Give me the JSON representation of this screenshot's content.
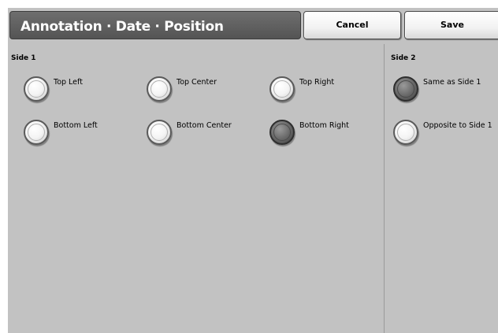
{
  "header": {
    "title": "Annotation · Date · Position",
    "cancel_label": "Cancel",
    "save_label": "Save"
  },
  "side1": {
    "label": "Side 1",
    "options": [
      {
        "label": "Top Left",
        "selected": false
      },
      {
        "label": "Top Center",
        "selected": false
      },
      {
        "label": "Top Right",
        "selected": false
      },
      {
        "label": "Bottom Left",
        "selected": false
      },
      {
        "label": "Bottom Center",
        "selected": false
      },
      {
        "label": "Bottom Right",
        "selected": true
      }
    ]
  },
  "side2": {
    "label": "Side 2",
    "options": [
      {
        "label": "Same as Side 1",
        "selected": true
      },
      {
        "label": "Opposite to Side 1",
        "selected": false
      }
    ]
  },
  "colors": {
    "background": "#c2c2c2",
    "title_bar": "#5e5e5e",
    "selected_radio": "#555555"
  }
}
